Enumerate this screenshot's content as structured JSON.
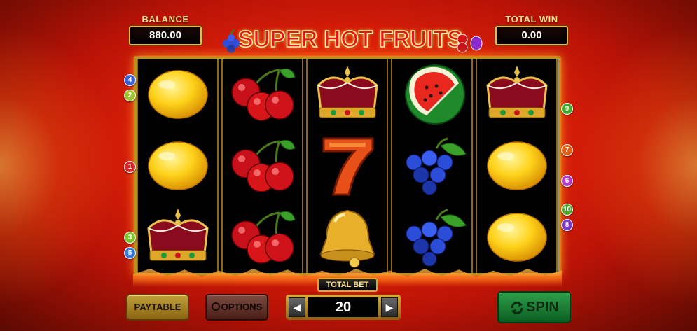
{
  "header": {
    "balance_label": "BALANCE",
    "balance_value": "880.00",
    "total_win_label": "TOTAL WIN",
    "total_win_value": "0.00",
    "logo_text": "SUPER HOT FRUITS"
  },
  "reels": [
    [
      "lemon",
      "lemon",
      "crown"
    ],
    [
      "cherries",
      "cherries",
      "cherries"
    ],
    [
      "crown",
      "seven",
      "bell"
    ],
    [
      "watermelon",
      "grapes",
      "grapes"
    ],
    [
      "crown",
      "lemon",
      "lemon"
    ]
  ],
  "paylines_left": [
    {
      "label": "4",
      "color": "#3a5fd8"
    },
    {
      "label": "2",
      "color": "#9bc42a"
    },
    {
      "label": "1",
      "color": "#d8262a"
    },
    {
      "label": "3",
      "color": "#7ac22a"
    },
    {
      "label": "5",
      "color": "#3a7ad8"
    }
  ],
  "paylines_right": [
    {
      "label": "9",
      "color": "#3ea82a"
    },
    {
      "label": "7",
      "color": "#e06018"
    },
    {
      "label": "6",
      "color": "#b03ac8"
    },
    {
      "label": "10",
      "color": "#4aa82a"
    },
    {
      "label": "8",
      "color": "#7a3ac8"
    }
  ],
  "footer": {
    "paytable_label": "PAYTABLE",
    "options_label": "OPTIONS",
    "total_bet_label": "TOTAL BET",
    "total_bet_value": "20",
    "spin_label": "SPIN"
  },
  "colors": {
    "background": "#d8200c",
    "reel_frame": "#b8921c",
    "logo_red": "#e7151b",
    "spin_green": "#1f8a3a"
  }
}
